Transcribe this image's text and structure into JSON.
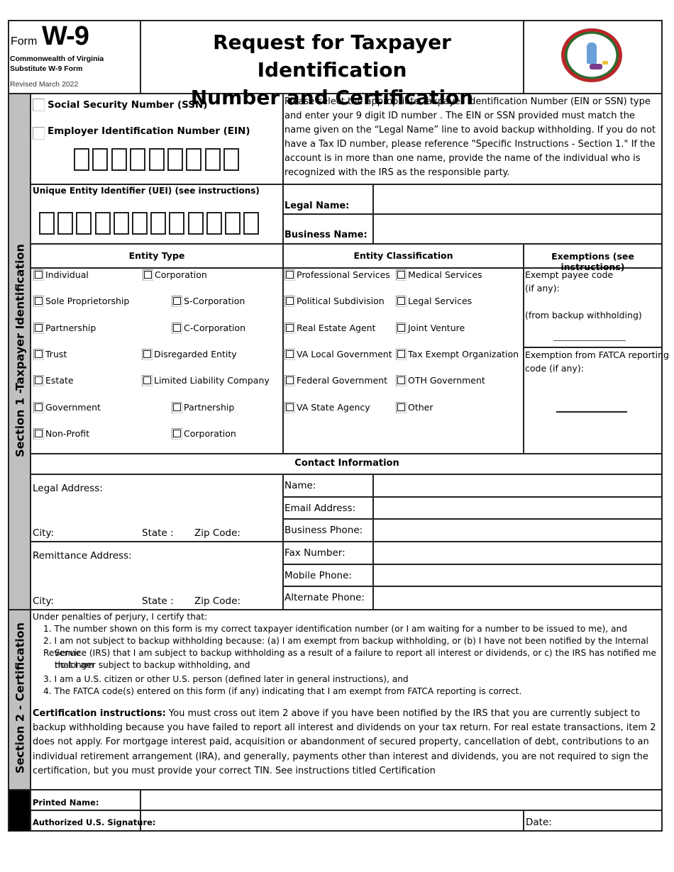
{
  "header": {
    "form_word": "Form",
    "form_number": "W-9",
    "subtitle_line1": "Commonwealth of Virginia",
    "subtitle_line2": "Substitute W-9 Form",
    "revised": "Revised March 2022",
    "title_line1": "Request for Taxpayer Identification",
    "title_line2": "Number and Certification",
    "seal_icon": "virginia-state-seal"
  },
  "section1": {
    "sidebar_label": "Section 1 -Taxpayer Identification",
    "tin": {
      "ssn_label": "Social Security Number (SSN)",
      "ein_label": "Employer Identification Number (EIN)",
      "digit_count": 9,
      "instructions": "Please select the appropriate Taxpayer Identification Number (EIN or SSN) type and enter your 9 digit ID number . The EIN or SSN provided must match the name given on the “Legal Name” line to avoid backup withholding. If you do not have a Tax ID number, please reference \"Specific Instructions - Section 1.\" If the account is in more than one name, provide the name of the individual who is recognized with the IRS as the responsible party."
    },
    "uei": {
      "label": "Unique Entity Identifier (UEI) (see instructions)",
      "digit_count": 12
    },
    "names": {
      "legal_name_label": "Legal Name:",
      "legal_name_value": "",
      "business_name_label": "Business Name:",
      "business_name_value": ""
    },
    "entity_type": {
      "header": "Entity Type",
      "left_options": [
        "Individual",
        "Sole Proprietorship",
        "Partnership",
        "Trust",
        "Estate",
        "Government",
        "Non-Profit"
      ],
      "right_options": [
        "Corporation",
        "S-Corporation",
        "C-Corporation",
        "Disregarded Entity",
        "Limited Liability Company",
        "Partnership",
        "Corporation"
      ]
    },
    "entity_classification": {
      "header": "Entity Classification",
      "left_options": [
        "Professional Services",
        "Political Subdivision",
        "Real Estate Agent",
        "VA Local Government",
        "Federal Government",
        "VA State Agency"
      ],
      "right_options": [
        "Medical Services",
        "Legal Services",
        "Joint Venture",
        "Tax Exempt Organization",
        "OTH Government",
        "Other"
      ]
    },
    "exemptions": {
      "header": "Exemptions (see instructions)",
      "payee_line1": "Exempt payee code",
      "payee_line2": "(if any):",
      "payee_line3": "(from backup withholding)",
      "payee_value": "",
      "fatca_line1": "Exemption from FATCA reporting",
      "fatca_line2": "code (if any):",
      "fatca_value": ""
    },
    "contact": {
      "header": "Contact Information",
      "legal_address_label": "Legal Address:",
      "remittance_address_label": "Remittance Address:",
      "city_label": "City:",
      "state_label": "State :",
      "zip_label": "Zip Code:",
      "fields": [
        {
          "label": "Name:",
          "value": ""
        },
        {
          "label": "Email Address:",
          "value": ""
        },
        {
          "label": "Business Phone:",
          "value": ""
        },
        {
          "label": "Fax Number:",
          "value": ""
        },
        {
          "label": "Mobile Phone:",
          "value": ""
        },
        {
          "label": "Alternate Phone:",
          "value": ""
        }
      ]
    }
  },
  "section2": {
    "sidebar_label": "Section 2 - Certification",
    "intro": "Under penalties of perjury, I certify that:",
    "items": [
      "1. The number shown on this form is my correct taxpayer identification number (or I am waiting for a number to be issued to me), and",
      "2. I am not subject to backup withholding because: (a) I am exempt from backup withholding, or (b) I have not been notified by the Internal Revenue",
      "Service (IRS) that I am subject to backup withholding as a result of a failure to report all interest or dividends, or c) the IRS has notified me that I am",
      "no longer subject to backup withholding, and",
      "3. I am a U.S. citizen or other U.S. person (defined later in general instructions), and",
      "4. The FATCA code(s) entered on this form (if any) indicating that I am exempt from FATCA reporting is correct."
    ],
    "instructions_bold": "Certification instructions:",
    "instructions_text": " You must cross out item 2 above if you have been notified by the IRS that you are currently subject to backup withholding because you have failed to report all interest and dividends on your tax return. For real estate transactions, item 2 does not apply. For mortgage interest paid, acquisition or abandonment of secured property, cancellation of debt, contributions to an individual retirement arrangement (IRA), and generally, payments other than interest and dividends, you are not required to sign the certification, but you must provide your correct TIN. See instructions titled Certification"
  },
  "signature": {
    "printed_name_label": "Printed Name:",
    "printed_name_value": "",
    "signature_label": "Authorized U.S. Signature:",
    "signature_value": "",
    "date_label": "Date:",
    "date_value": ""
  }
}
